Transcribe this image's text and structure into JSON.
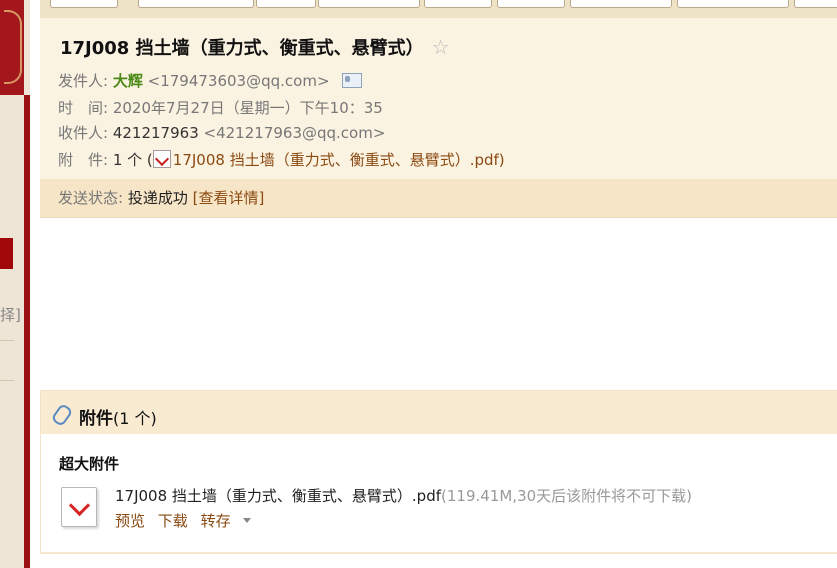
{
  "left_sidebar": {
    "partial_text": "择]"
  },
  "header": {
    "subject": "17J008 挡土墙（重力式、衡重式、悬臂式）",
    "sender_label": "发件人:",
    "sender_name": "大辉",
    "sender_email": "<179473603@qq.com>",
    "time_label": "时　间:",
    "time_value": "2020年7月27日（星期一）下午10：35",
    "recipient_label": "收件人:",
    "recipient_name": "421217963",
    "recipient_email": "<421217963@qq.com>",
    "attachment_label": "附　件:",
    "attachment_count": "1 个 (",
    "attachment_name": "17J008 挡土墙（重力式、衡重式、悬臂式）.pdf",
    "attachment_close": ")"
  },
  "status": {
    "label": "发送状态:",
    "value": "投递成功",
    "details_link": "[查看详情]"
  },
  "attachments": {
    "title": "附件",
    "count": "(1 个)",
    "big_label": "超大附件",
    "file_name": "17J008 挡土墙（重力式、衡重式、悬臂式）.pdf",
    "file_info": "(119.41M,30天后该附件将不可下载)",
    "actions": {
      "preview": "预览",
      "download": "下载",
      "save": "转存"
    }
  },
  "icons": {
    "star": "star-icon",
    "contact_card": "contact-card-icon",
    "pdf": "pdf-icon",
    "paperclip": "paperclip-icon"
  },
  "colors": {
    "header_bg": "#fbf3e2",
    "status_bg": "#f6e5c6",
    "sender_green": "#4b8a17",
    "link_brown": "#8a4a12",
    "sidebar_red": "#a3161b"
  }
}
